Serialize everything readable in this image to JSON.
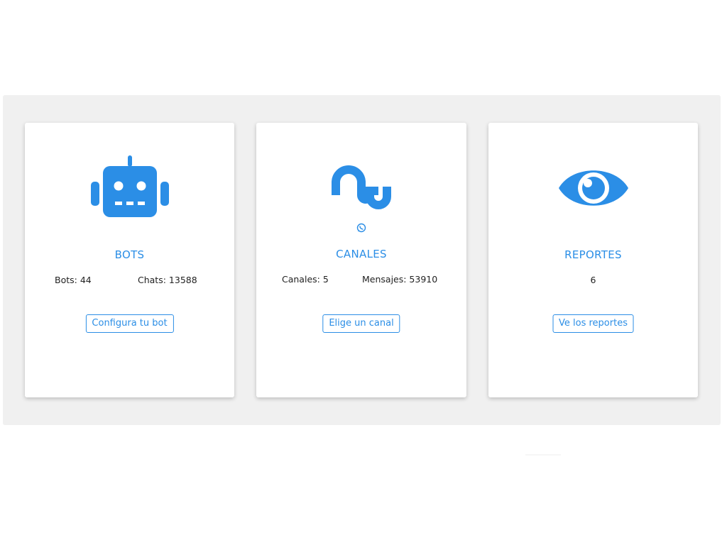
{
  "colors": {
    "accent": "#2b8ee6",
    "panel_bg": "#f0f0f0",
    "card_bg": "#ffffff",
    "text": "#222222"
  },
  "cards": [
    {
      "icon": "robot-icon",
      "title": "BOTS",
      "stats": [
        {
          "label": "Bots: 44"
        },
        {
          "label": "Chats: 13588"
        }
      ],
      "button": "Configura tu bot"
    },
    {
      "icon": "stumbleupon-icon",
      "sub_icon": "whatsapp-icon",
      "title": "CANALES",
      "stats": [
        {
          "label": "Canales: 5"
        },
        {
          "label": "Mensajes: 53910"
        }
      ],
      "button": "Elige un canal"
    },
    {
      "icon": "eye-icon",
      "title": "REPORTES",
      "value": "6",
      "button": "Ve los reportes"
    }
  ]
}
